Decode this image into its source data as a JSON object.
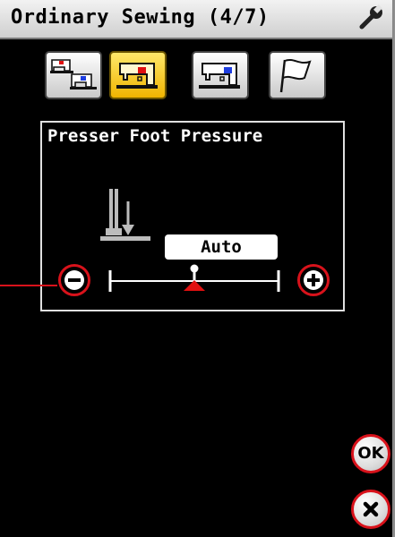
{
  "header": {
    "title": "Ordinary Sewing (4/7)",
    "settings_icon": "wrench-icon"
  },
  "tabs": [
    {
      "icon": "two-machines-icon",
      "active": false
    },
    {
      "icon": "sewing-machine-red-icon",
      "active": true
    },
    {
      "icon": "sewing-machine-blue-icon",
      "active": false
    },
    {
      "icon": "flag-icon",
      "active": false
    }
  ],
  "panel": {
    "title": "Presser Foot Pressure",
    "value": "Auto",
    "slider_position": 0.5
  },
  "buttons": {
    "ok_label": "OK"
  },
  "colors": {
    "accent_red": "#d8121b",
    "active_tab": "#f5c400",
    "background": "#000000"
  }
}
